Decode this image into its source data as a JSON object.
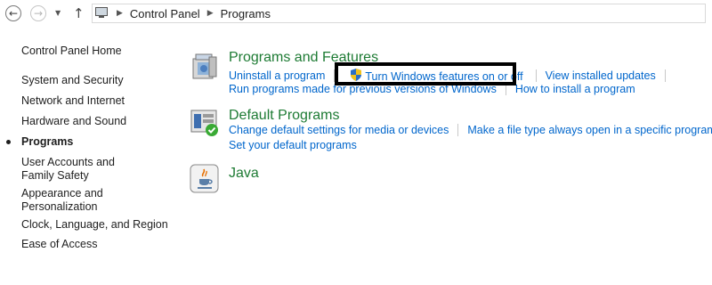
{
  "breadcrumb": {
    "items": [
      "Control Panel",
      "Programs"
    ]
  },
  "sidebar": {
    "items": [
      {
        "label": "Control Panel Home"
      },
      {
        "label": "System and Security"
      },
      {
        "label": "Network and Internet"
      },
      {
        "label": "Hardware and Sound"
      },
      {
        "label": "Programs",
        "current": true
      },
      {
        "label": "User Accounts and Family Safety"
      },
      {
        "label": "Appearance and Personalization"
      },
      {
        "label": "Clock, Language, and Region"
      },
      {
        "label": "Ease of Access"
      }
    ]
  },
  "sections": {
    "programs_features": {
      "title": "Programs and Features",
      "links": {
        "uninstall": "Uninstall a program",
        "windows_features": "Turn Windows features on or off",
        "installed_updates": "View installed updates",
        "compat": "Run programs made for previous versions of Windows",
        "how_install": "How to install a program"
      }
    },
    "default_programs": {
      "title": "Default Programs",
      "links": {
        "change_defaults": "Change default settings for media or devices",
        "file_type": "Make a file type always open in a specific program",
        "set_defaults": "Set your default programs"
      }
    },
    "java": {
      "title": "Java"
    }
  },
  "colors": {
    "section_title": "#1e7b34",
    "link": "#0066cc",
    "highlight_border": "#000000"
  }
}
